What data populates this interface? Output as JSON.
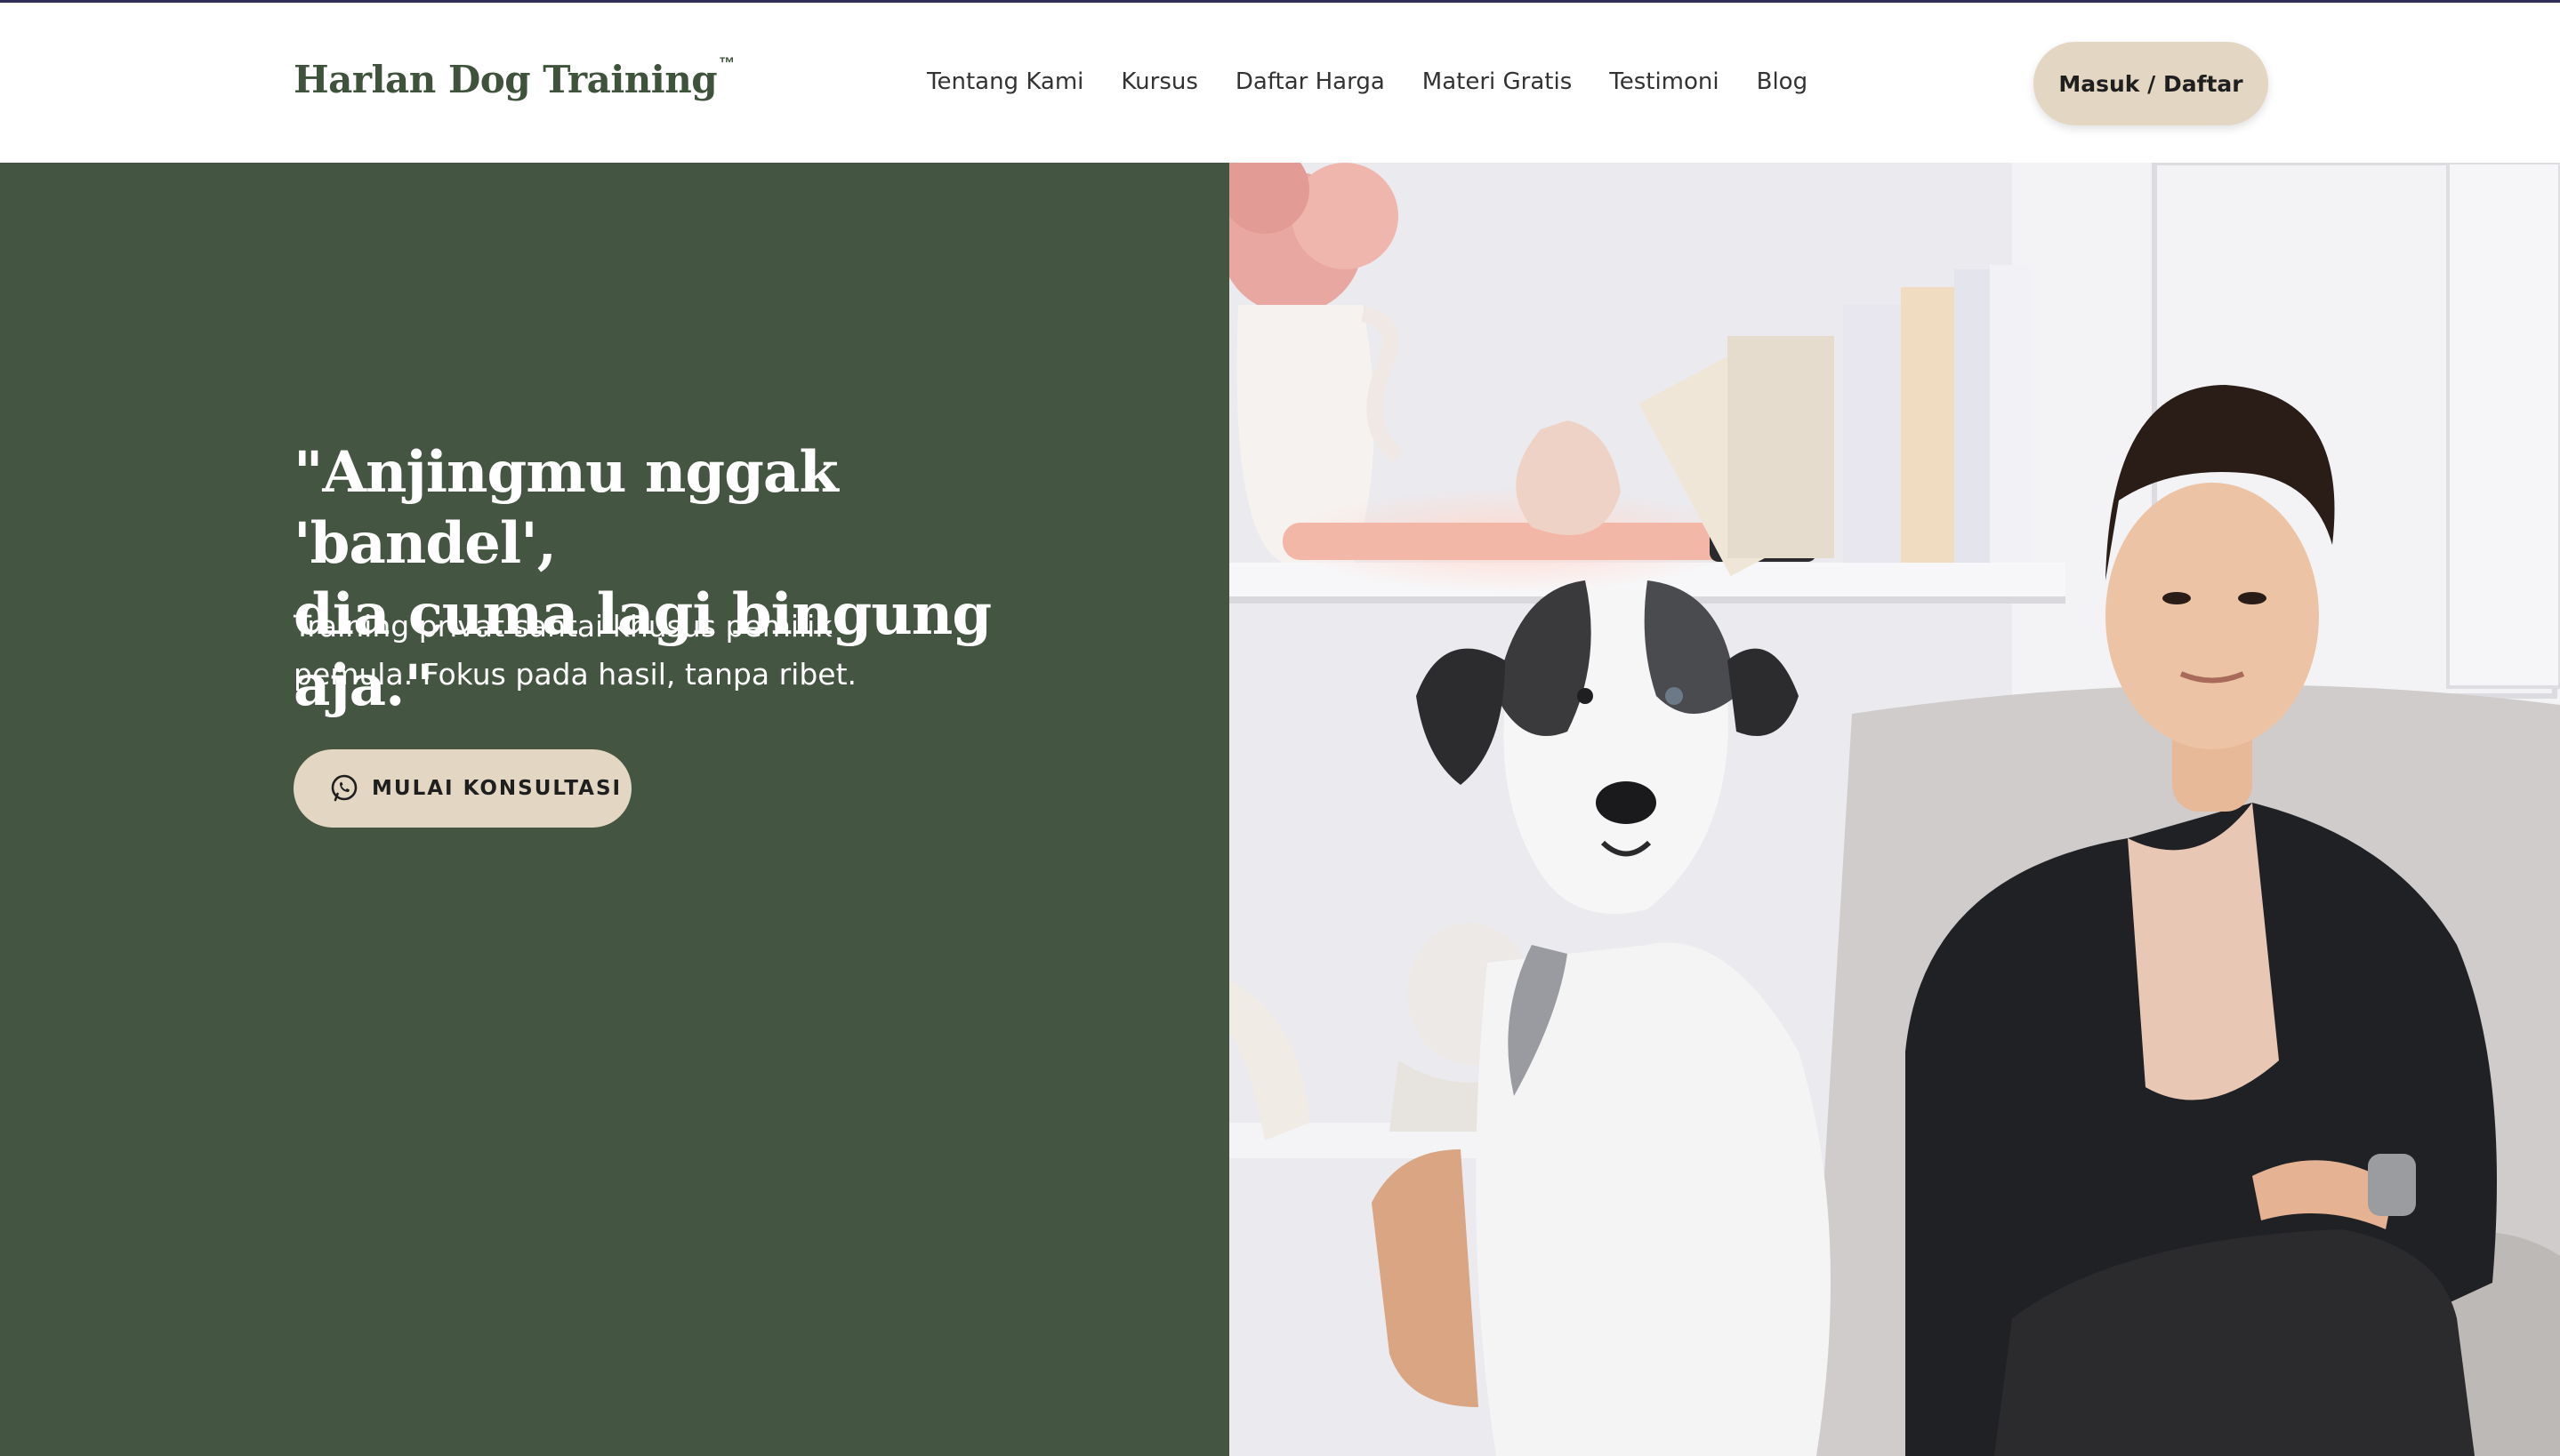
{
  "header": {
    "brand": "Harlan Dog Training",
    "brand_mark": "™",
    "nav": [
      "Tentang Kami",
      "Kursus",
      "Daftar Harga",
      "Materi Gratis",
      "Testimoni",
      "Blog"
    ],
    "login_label": "Masuk / Daftar"
  },
  "hero": {
    "quote_line1": "\"Anjingmu nggak 'bandel',",
    "quote_line2": "dia cuma lagi bingung aja.\"",
    "sub_line1": "Training privat santai khusus pemilik",
    "sub_line2": "pemula. Fokus pada hasil, tanpa ribet.",
    "cta_label": "MULAI KONSULTASI",
    "cta_icon": "whatsapp-icon"
  },
  "colors": {
    "accent_green": "#445541",
    "brand_text": "#3f523c",
    "button_beige": "#e3d7c3",
    "top_line": "#2f2c55"
  }
}
